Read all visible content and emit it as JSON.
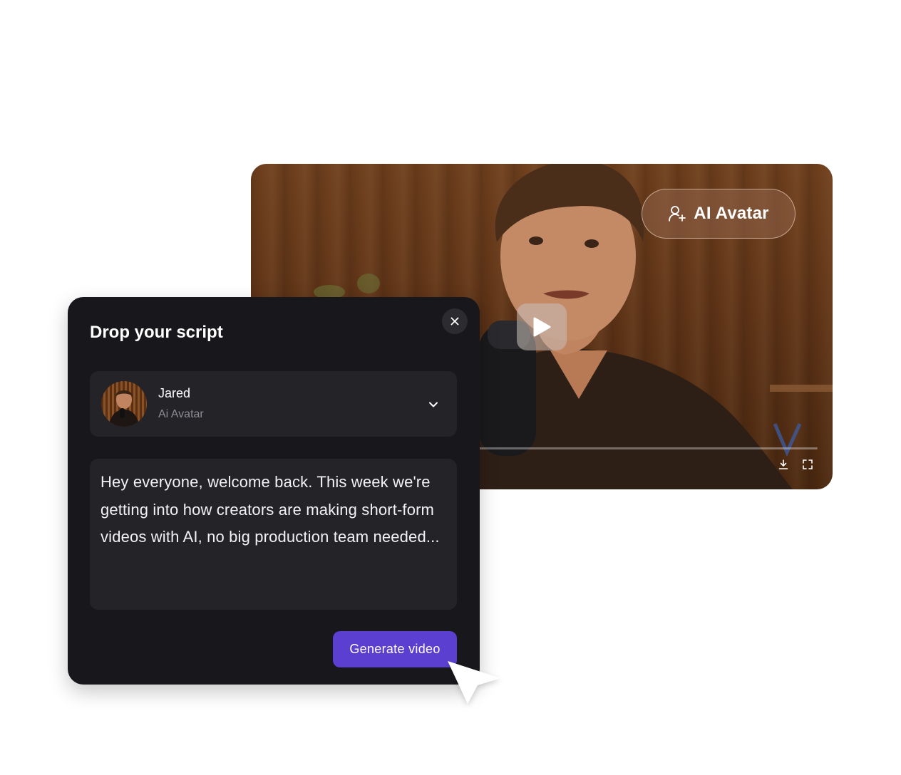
{
  "video": {
    "badge_label": "AI Avatar",
    "badge_icon": "user-sparkle-icon",
    "play_icon": "play-icon",
    "download_icon": "download-icon",
    "fullscreen_icon": "fullscreen-icon"
  },
  "panel": {
    "title": "Drop your script",
    "close_icon": "close-icon",
    "avatar": {
      "name": "Jared",
      "type": "Ai Avatar",
      "dropdown_icon": "chevron-down-icon"
    },
    "script_text": "Hey everyone, welcome back. This week we're getting into how creators are making short-form videos with AI, no big production team needed...",
    "generate_label": "Generate video"
  },
  "colors": {
    "panel_bg": "#18171b",
    "field_bg": "#242328",
    "accent": "#5b3fd0",
    "video_bg": "#5f3417"
  }
}
